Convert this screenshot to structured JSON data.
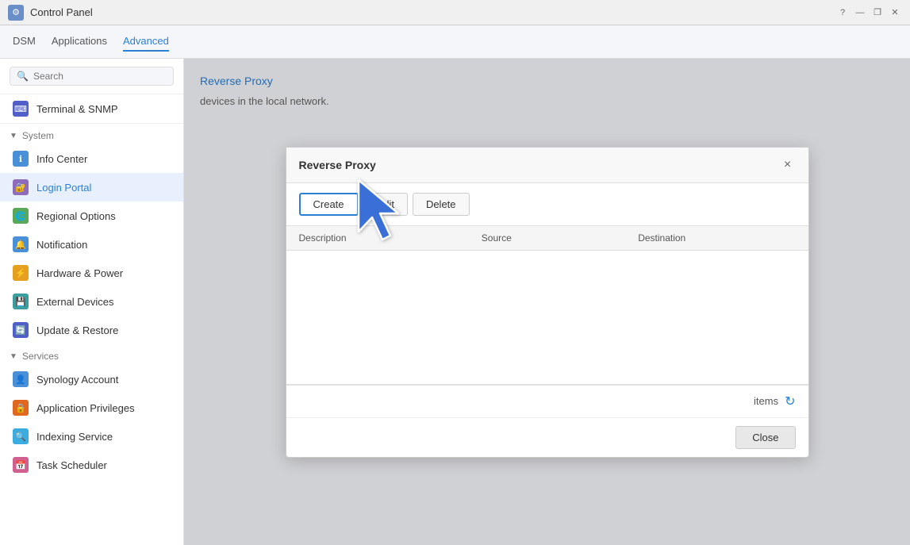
{
  "titlebar": {
    "title": "Control Panel",
    "help": "?",
    "minimize": "—",
    "restore": "❐",
    "close": "✕"
  },
  "topnav": {
    "tabs": [
      {
        "id": "dsm",
        "label": "DSM",
        "active": false
      },
      {
        "id": "applications",
        "label": "Applications",
        "active": false
      },
      {
        "id": "advanced",
        "label": "Advanced",
        "active": true
      }
    ]
  },
  "sidebar": {
    "search_placeholder": "Search",
    "terminal_item": "Terminal & SNMP",
    "system_section": "System",
    "items": [
      {
        "id": "info-center",
        "label": "Info Center",
        "icon": "ℹ",
        "color": "icon-blue",
        "active": false
      },
      {
        "id": "login-portal",
        "label": "Login Portal",
        "icon": "👤",
        "color": "icon-purple",
        "active": true
      },
      {
        "id": "regional-options",
        "label": "Regional Options",
        "icon": "🌐",
        "color": "icon-green",
        "active": false
      },
      {
        "id": "notification",
        "label": "Notification",
        "icon": "🔔",
        "color": "icon-blue",
        "active": false
      },
      {
        "id": "hardware-power",
        "label": "Hardware & Power",
        "icon": "⚡",
        "color": "icon-yellow",
        "active": false
      },
      {
        "id": "external-devices",
        "label": "External Devices",
        "icon": "💾",
        "color": "icon-teal",
        "active": false
      },
      {
        "id": "update-restore",
        "label": "Update & Restore",
        "icon": "🔄",
        "color": "icon-indigo",
        "active": false
      }
    ],
    "services_section": "Services",
    "service_items": [
      {
        "id": "synology-account",
        "label": "Synology Account",
        "icon": "👤",
        "color": "icon-blue",
        "active": false
      },
      {
        "id": "application-privileges",
        "label": "Application Privileges",
        "icon": "🔒",
        "color": "icon-orange",
        "active": false
      },
      {
        "id": "indexing-service",
        "label": "Indexing Service",
        "icon": "🔍",
        "color": "icon-cyan",
        "active": false
      },
      {
        "id": "task-scheduler",
        "label": "Task Scheduler",
        "icon": "📅",
        "color": "icon-pink",
        "active": false
      }
    ]
  },
  "content": {
    "reverse_proxy_link": "Reverse Proxy",
    "description": "devices in the local network."
  },
  "dialog": {
    "title": "Reverse Proxy",
    "close_icon": "×",
    "buttons": {
      "create": "Create",
      "edit": "Edit",
      "delete": "Delete"
    },
    "table": {
      "columns": [
        {
          "id": "description",
          "label": "Description"
        },
        {
          "id": "source",
          "label": "Source"
        },
        {
          "id": "destination",
          "label": "Destination"
        }
      ]
    },
    "footer": {
      "items_label": "items",
      "refresh_icon": "↻"
    },
    "close_button": "Close"
  }
}
